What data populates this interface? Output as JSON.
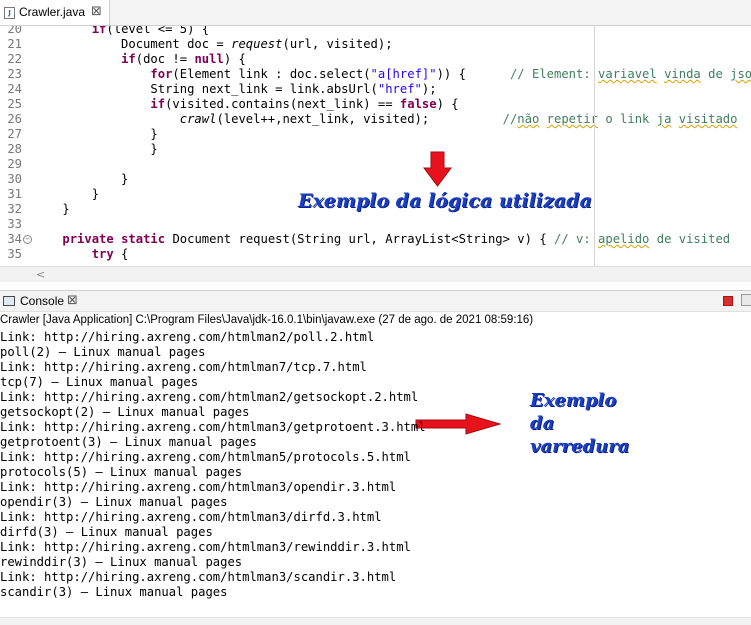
{
  "editor_tab": {
    "title": "Crawler.java",
    "icon": "java-file-icon",
    "close_glyph": "⊠"
  },
  "editor": {
    "lines": [
      {
        "n": "20",
        "segs": [
          [
            "        ",
            ""
          ],
          [
            "if",
            "kw"
          ],
          [
            "(level <= 5) {",
            ""
          ]
        ]
      },
      {
        "n": "21",
        "segs": [
          [
            "            Document doc = ",
            ""
          ],
          [
            "request",
            "it"
          ],
          [
            "(url, visited);",
            ""
          ]
        ]
      },
      {
        "n": "22",
        "segs": [
          [
            "            ",
            ""
          ],
          [
            "if",
            "kw"
          ],
          [
            "(doc != ",
            ""
          ],
          [
            "null",
            "kw"
          ],
          [
            ") {",
            ""
          ]
        ]
      },
      {
        "n": "23",
        "segs": [
          [
            "                ",
            ""
          ],
          [
            "for",
            "kw"
          ],
          [
            "(Element link : doc.select(",
            ""
          ],
          [
            "\"a[href]\"",
            "str"
          ],
          [
            ")) {      ",
            ""
          ],
          [
            "// Element: ",
            "cm"
          ],
          [
            "variavel",
            "cm sq"
          ],
          [
            " ",
            "cm"
          ],
          [
            "vinda",
            "cm sq"
          ],
          [
            " de ",
            "cm"
          ],
          [
            "jsoup",
            "cm sq"
          ]
        ]
      },
      {
        "n": "24",
        "segs": [
          [
            "                String next_link = link.absUrl(",
            ""
          ],
          [
            "\"href\"",
            "str"
          ],
          [
            ");",
            ""
          ]
        ]
      },
      {
        "n": "25",
        "segs": [
          [
            "                ",
            ""
          ],
          [
            "if",
            "kw"
          ],
          [
            "(visited.contains(next_link) == ",
            ""
          ],
          [
            "false",
            "kw"
          ],
          [
            ") {",
            ""
          ]
        ]
      },
      {
        "n": "26",
        "segs": [
          [
            "                    ",
            ""
          ],
          [
            "crawl",
            "it"
          ],
          [
            "(level++,next_link, visited);          ",
            ""
          ],
          [
            "//",
            "cm"
          ],
          [
            "não",
            "cm sq"
          ],
          [
            " ",
            "cm"
          ],
          [
            "repetir",
            "cm sq"
          ],
          [
            " o link ",
            "cm"
          ],
          [
            "ja",
            "cm sq"
          ],
          [
            " ",
            "cm"
          ],
          [
            "visitado",
            "cm sq"
          ]
        ]
      },
      {
        "n": "27",
        "segs": [
          [
            "                }",
            ""
          ]
        ]
      },
      {
        "n": "28",
        "segs": [
          [
            "                }",
            ""
          ]
        ]
      },
      {
        "n": "29",
        "segs": [
          [
            "",
            ""
          ]
        ]
      },
      {
        "n": "30",
        "segs": [
          [
            "            }",
            ""
          ]
        ]
      },
      {
        "n": "31",
        "segs": [
          [
            "        }",
            ""
          ]
        ]
      },
      {
        "n": "32",
        "segs": [
          [
            "    }",
            ""
          ]
        ]
      },
      {
        "n": "33",
        "segs": [
          [
            "",
            ""
          ]
        ]
      },
      {
        "n": "34",
        "fold": true,
        "segs": [
          [
            "    ",
            ""
          ],
          [
            "private",
            "kw"
          ],
          [
            " ",
            ""
          ],
          [
            "static",
            "kw"
          ],
          [
            " Document request(String url, ArrayList<String> v) { ",
            ""
          ],
          [
            "// v: ",
            "cm"
          ],
          [
            "apelido",
            "cm sq"
          ],
          [
            " de visited",
            "cm"
          ]
        ]
      },
      {
        "n": "35",
        "segs": [
          [
            "        ",
            ""
          ],
          [
            "try",
            "kw"
          ],
          [
            " {",
            ""
          ]
        ]
      }
    ]
  },
  "annotations": {
    "logic": "Exemplo da lógica utilizada",
    "scan": "Exemplo\nda\nvarredura"
  },
  "arrow_color": "#e8121d",
  "console_tab": {
    "title": "Console",
    "close_glyph": "⊠"
  },
  "console": {
    "description": "Crawler [Java Application] C:\\Program Files\\Java\\jdk-16.0.1\\bin\\javaw.exe  (27 de ago. de 2021 08:59:16)",
    "output": [
      "Link: http://hiring.axreng.com/htmlman2/poll.2.html",
      "poll(2) — Linux manual pages",
      "Link: http://hiring.axreng.com/htmlman7/tcp.7.html",
      "tcp(7) — Linux manual pages",
      "Link: http://hiring.axreng.com/htmlman2/getsockopt.2.html",
      "getsockopt(2) — Linux manual pages",
      "Link: http://hiring.axreng.com/htmlman3/getprotoent.3.html",
      "getprotoent(3) — Linux manual pages",
      "Link: http://hiring.axreng.com/htmlman5/protocols.5.html",
      "protocols(5) — Linux manual pages",
      "Link: http://hiring.axreng.com/htmlman3/opendir.3.html",
      "opendir(3) — Linux manual pages",
      "Link: http://hiring.axreng.com/htmlman3/dirfd.3.html",
      "dirfd(3) — Linux manual pages",
      "Link: http://hiring.axreng.com/htmlman3/rewinddir.3.html",
      "rewinddir(3) — Linux manual pages",
      "Link: http://hiring.axreng.com/htmlman3/scandir.3.html",
      "scandir(3) — Linux manual pages"
    ]
  }
}
